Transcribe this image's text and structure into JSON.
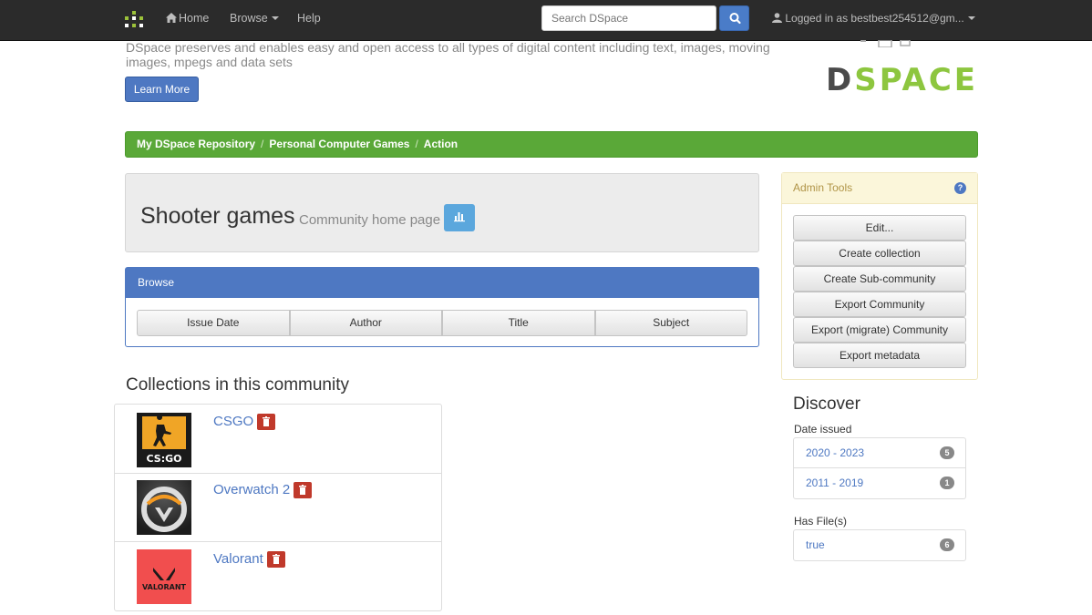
{
  "navbar": {
    "home_label": "Home",
    "browse_label": "Browse",
    "help_label": "Help",
    "search_placeholder": "Search DSpace",
    "user_label": "Logged in as bestbest254512@gm..."
  },
  "hero": {
    "text": "DSpace preserves and enables easy and open access to all types of digital content including text, images, moving images, mpegs and data sets",
    "learn_more": "Learn More",
    "logo_text_d": "D",
    "logo_text_rest": "SPACE"
  },
  "breadcrumb": [
    "My DSpace Repository",
    "Personal Computer Games",
    "Action"
  ],
  "page": {
    "title": "Shooter games",
    "subtitle": "Community home page"
  },
  "browse": {
    "heading": "Browse",
    "buttons": [
      "Issue Date",
      "Author",
      "Title",
      "Subject"
    ]
  },
  "collections": {
    "heading": "Collections in this community",
    "items": [
      {
        "name": "CSGO",
        "thumb_caption": "CS:GO"
      },
      {
        "name": "Overwatch 2",
        "thumb_caption": ""
      },
      {
        "name": "Valorant",
        "thumb_caption": "VALORANT"
      }
    ]
  },
  "admin_tools": {
    "heading": "Admin Tools",
    "buttons": [
      "Edit...",
      "Create collection",
      "Create Sub-community",
      "Export Community",
      "Export (migrate) Community",
      "Export metadata"
    ]
  },
  "discover": {
    "heading": "Discover",
    "date_label": "Date issued",
    "dates": [
      {
        "label": "2020 - 2023",
        "count": "5"
      },
      {
        "label": "2011 - 2019",
        "count": "1"
      }
    ],
    "files_label": "Has File(s)",
    "files": [
      {
        "label": "true",
        "count": "6"
      }
    ]
  },
  "colors": {
    "navbar": "#2b2b2b",
    "primary": "#4e78c2",
    "breadcrumb": "#5aa838",
    "danger": "#c0392b",
    "brand_green": "#8dc63f"
  }
}
